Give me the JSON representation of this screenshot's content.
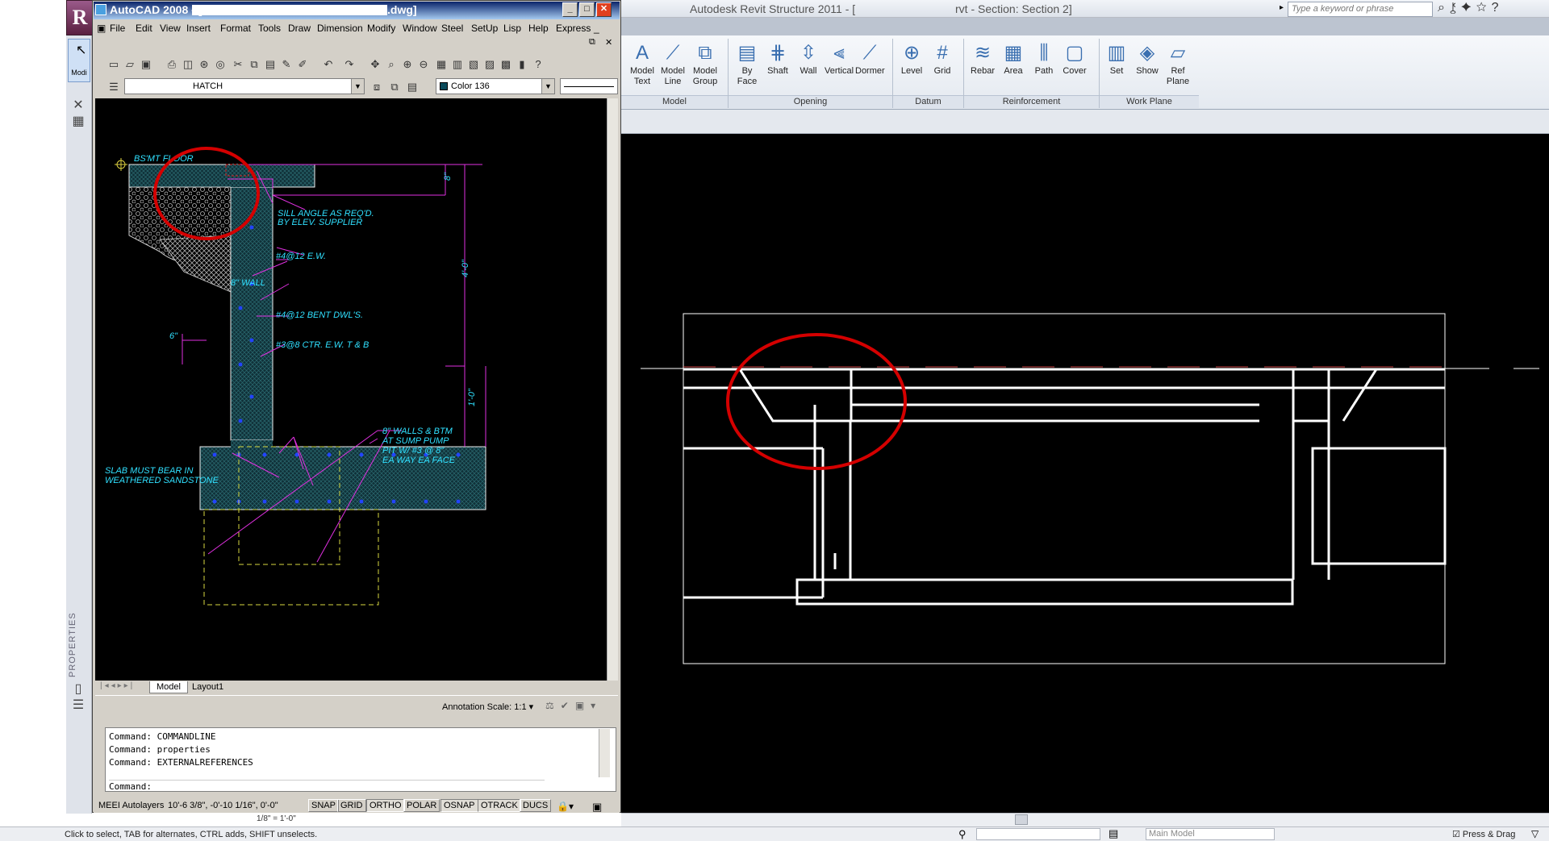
{
  "revit": {
    "app_button": "R",
    "title_app": "Autodesk Revit Structure 2011 - [",
    "title_doc": "rvt - Section: Section 2]",
    "search_placeholder": "Type a keyword or phrase",
    "modify_label": "Modi",
    "properties_label": "PROPERTIES",
    "tools": [
      {
        "label": "Model\nText",
        "icon": "text-icon"
      },
      {
        "label": "Model\nLine",
        "icon": "line-icon"
      },
      {
        "label": "Model\nGroup",
        "icon": "group-icon"
      },
      {
        "label": "By\nFace",
        "icon": "byface-icon"
      },
      {
        "label": "Shaft",
        "icon": "shaft-icon"
      },
      {
        "label": "Wall",
        "icon": "wall-icon"
      },
      {
        "label": "Vertical",
        "icon": "vertical-icon"
      },
      {
        "label": "Dormer",
        "icon": "dormer-icon"
      },
      {
        "label": "Level",
        "icon": "level-icon"
      },
      {
        "label": "Grid",
        "icon": "grid-icon"
      },
      {
        "label": "Rebar",
        "icon": "rebar-icon"
      },
      {
        "label": "Area",
        "icon": "area-icon"
      },
      {
        "label": "Path",
        "icon": "path-icon"
      },
      {
        "label": "Cover",
        "icon": "cover-icon"
      },
      {
        "label": "Set",
        "icon": "set-icon"
      },
      {
        "label": "Show",
        "icon": "show-icon"
      },
      {
        "label": "Ref\nPlane",
        "icon": "refplane-icon"
      }
    ],
    "panels": [
      "Model",
      "Opening",
      "Datum",
      "Reinforcement",
      "Work Plane"
    ],
    "status_hint": "Click to select, TAB for alternates, CTRL adds, SHIFT unselects.",
    "status_model": "Main Model",
    "status_press_drag": "Press & Drag"
  },
  "acad": {
    "title_prefix": "AutoCAD 2008 - [K:\\",
    "title_suffix": ".dwg]",
    "menus": [
      "File",
      "Edit",
      "View",
      "Insert",
      "Format",
      "Tools",
      "Draw",
      "Dimension",
      "Modify",
      "Window",
      "Steel",
      "SetUp",
      "Lisp",
      "Help",
      "Express"
    ],
    "layer_value": "HATCH",
    "color_value": "Color 136",
    "tabs": [
      "Model",
      "Layout1"
    ],
    "annotation_scale_label": "Annotation Scale:",
    "annotation_scale_value": "1:1",
    "command_history": [
      "Command: COMMANDLINE",
      "Command: properties",
      "Command: EXTERNALREFERENCES"
    ],
    "command_prompt": "Command:",
    "status_layer": "MEEI Autolayers",
    "status_coords": "10'-6 3/8\",  -0'-10 1/16\", 0'-0\"",
    "status_toggles": [
      "SNAP",
      "GRID",
      "ORTHO",
      "POLAR",
      "OSNAP",
      "OTRACK",
      "DUCS"
    ],
    "status_scale": "1/8\" = 1'-0\"",
    "drawing_labels": {
      "bsmt_floor": "BS'MT FLOOR",
      "dim_8": "8\"",
      "sill_1": "SILL ANGLE AS REQ'D.",
      "sill_2": "BY ELEV. SUPPLIER",
      "rebar_ew": "#4@12 E.W.",
      "wall_8": "8\" WALL",
      "dim_4ft": "4'-0\"",
      "bent_dwl": "#4@12 BENT DWL'S.",
      "dim_6": "6\"",
      "ctr_ew": "#3@8 CTR. E.W. T & B",
      "dim_1ft": "1'-0\"",
      "walls_1": "8\" WALLS & BTM",
      "walls_2": "AT SUMP PUMP",
      "walls_3": "PIT W/ #3 @ 8\"",
      "walls_4": "EA WAY EA FACE",
      "slab_1": "SLAB MUST BEAR IN",
      "slab_2": "WEATHERED SANDSTONE"
    }
  }
}
